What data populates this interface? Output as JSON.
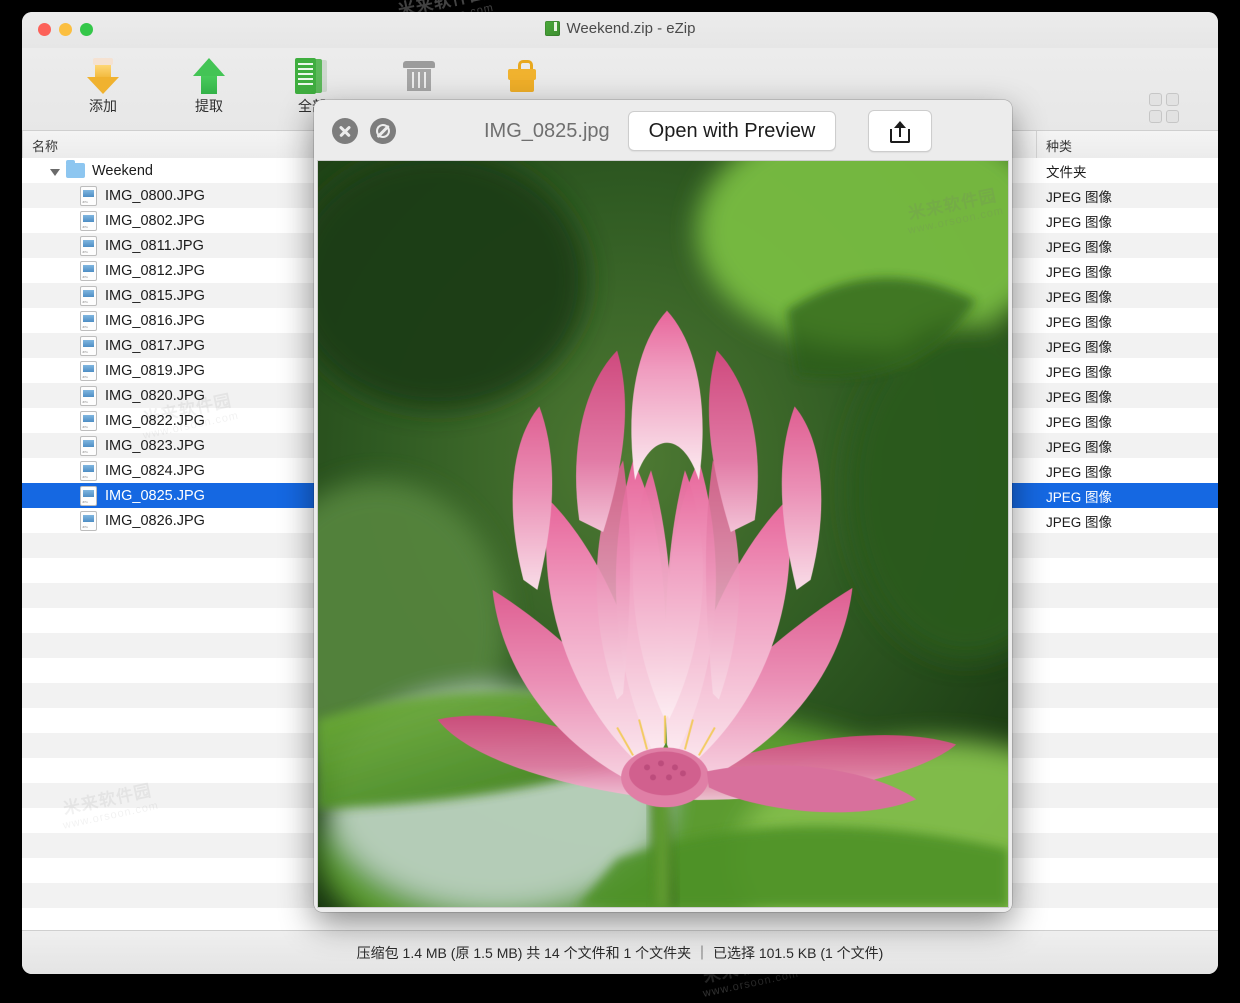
{
  "window": {
    "title": "Weekend.zip - eZip",
    "title_icon": "zip-archive-icon",
    "traffic_lights": [
      "close",
      "minimize",
      "zoom"
    ]
  },
  "toolbar": {
    "items": [
      {
        "label": "添加",
        "icon": "add-down-arrow-icon"
      },
      {
        "label": "提取",
        "icon": "extract-up-arrow-icon"
      },
      {
        "label": "全部",
        "icon": "extract-all-documents-icon"
      },
      {
        "label": "",
        "icon": "trash-icon"
      },
      {
        "label": "",
        "icon": "lock-encrypt-icon"
      }
    ],
    "right_items": [
      {
        "icon": "grid-view-icon"
      },
      {
        "icon": "photo-preview-icon"
      },
      {
        "icon": "search-icon"
      }
    ]
  },
  "file_list": {
    "columns": [
      {
        "key": "name",
        "label": "名称"
      },
      {
        "key": "kind",
        "label": "种类"
      }
    ],
    "rows": [
      {
        "name": "Weekend",
        "kind": "文件夹",
        "icon": "folder-icon",
        "depth": 0,
        "expanded": true,
        "selected": false
      },
      {
        "name": "IMG_0800.JPG",
        "kind": "JPEG 图像",
        "icon": "jpeg-file-icon",
        "depth": 1,
        "selected": false
      },
      {
        "name": "IMG_0802.JPG",
        "kind": "JPEG 图像",
        "icon": "jpeg-file-icon",
        "depth": 1,
        "selected": false
      },
      {
        "name": "IMG_0811.JPG",
        "kind": "JPEG 图像",
        "icon": "jpeg-file-icon",
        "depth": 1,
        "selected": false
      },
      {
        "name": "IMG_0812.JPG",
        "kind": "JPEG 图像",
        "icon": "jpeg-file-icon",
        "depth": 1,
        "selected": false
      },
      {
        "name": "IMG_0815.JPG",
        "kind": "JPEG 图像",
        "icon": "jpeg-file-icon",
        "depth": 1,
        "selected": false
      },
      {
        "name": "IMG_0816.JPG",
        "kind": "JPEG 图像",
        "icon": "jpeg-file-icon",
        "depth": 1,
        "selected": false
      },
      {
        "name": "IMG_0817.JPG",
        "kind": "JPEG 图像",
        "icon": "jpeg-file-icon",
        "depth": 1,
        "selected": false
      },
      {
        "name": "IMG_0819.JPG",
        "kind": "JPEG 图像",
        "icon": "jpeg-file-icon",
        "depth": 1,
        "selected": false
      },
      {
        "name": "IMG_0820.JPG",
        "kind": "JPEG 图像",
        "icon": "jpeg-file-icon",
        "depth": 1,
        "selected": false
      },
      {
        "name": "IMG_0822.JPG",
        "kind": "JPEG 图像",
        "icon": "jpeg-file-icon",
        "depth": 1,
        "selected": false
      },
      {
        "name": "IMG_0823.JPG",
        "kind": "JPEG 图像",
        "icon": "jpeg-file-icon",
        "depth": 1,
        "selected": false
      },
      {
        "name": "IMG_0824.JPG",
        "kind": "JPEG 图像",
        "icon": "jpeg-file-icon",
        "depth": 1,
        "selected": false
      },
      {
        "name": "IMG_0825.JPG",
        "kind": "JPEG 图像",
        "icon": "jpeg-file-icon",
        "depth": 1,
        "selected": true
      },
      {
        "name": "IMG_0826.JPG",
        "kind": "JPEG 图像",
        "icon": "jpeg-file-icon",
        "depth": 1,
        "selected": false
      }
    ],
    "empty_rows": 16,
    "selection_color": "#1568e2"
  },
  "quicklook": {
    "filename": "IMG_0825.jpg",
    "open_button_label": "Open with Preview",
    "close_icon": "close-circle-icon",
    "fullscreen_icon": "no-entry-circle-icon",
    "share_icon": "share-upload-icon",
    "image_subject": "pink lotus flower"
  },
  "status": {
    "text": "压缩包 1.4 MB (原 1.5 MB) 共 14 个文件和 1 个文件夹  ｜  已选择 101.5 KB (1 个文件)"
  },
  "watermark": {
    "cn": "米来软件园",
    "url": "www.orsoon.com"
  }
}
